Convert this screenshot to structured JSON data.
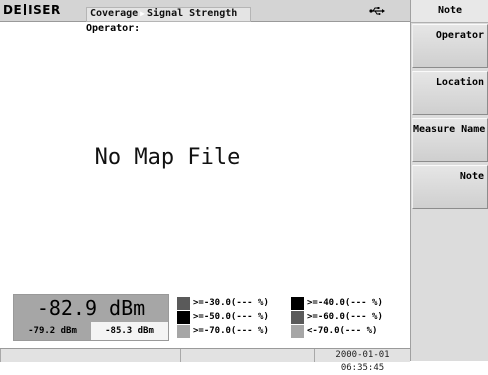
{
  "header": {
    "logo_left": "DE",
    "logo_right": "ISER",
    "breadcrumb": [
      "Coverage",
      "Signal Strength"
    ],
    "operator_label": "Operator:"
  },
  "map": {
    "message": "No Map File"
  },
  "right_panel": {
    "title": "Note",
    "softkeys": [
      "Operator",
      "Location",
      "Measure Name",
      "Note"
    ]
  },
  "readout": {
    "current": "-82.9 dBm",
    "min": "-79.2 dBm",
    "max": "-85.3 dBm"
  },
  "legend": [
    {
      "label": ">=-30.0(--- %)",
      "color": "#5a5a5a"
    },
    {
      "label": ">=-40.0(--- %)",
      "color": "#000000"
    },
    {
      "label": ">=-50.0(--- %)",
      "color": "#000000"
    },
    {
      "label": ">=-60.0(--- %)",
      "color": "#5a5a5a"
    },
    {
      "label": ">=-70.0(--- %)",
      "color": "#a6a6a6"
    },
    {
      "label": "<-70.0(--- %)",
      "color": "#a6a6a6"
    }
  ],
  "status": {
    "datetime": "2000-01-01 06:35:45"
  },
  "icons": {
    "usb": "usb-icon"
  }
}
